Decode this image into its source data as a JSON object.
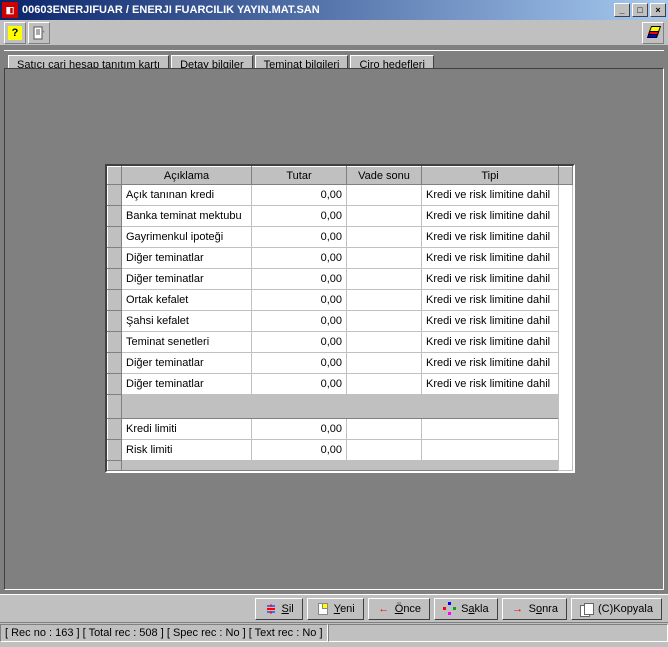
{
  "window": {
    "title": "00603ENERJIFUAR / ENERJI FUARCILIK YAYIN.MAT.SAN"
  },
  "tabs": [
    {
      "label": "Satıcı cari hesap tanıtım kartı",
      "active": false
    },
    {
      "label": "Detay bilgiler",
      "active": false
    },
    {
      "label": "Teminat bilgileri",
      "active": true
    },
    {
      "label": "Ciro hedefleri",
      "active": false
    }
  ],
  "table": {
    "headers": {
      "desc": "Açıklama",
      "amount": "Tutar",
      "due": "Vade sonu",
      "type": "Tipi"
    },
    "rows": [
      {
        "desc": "Açık tanınan kredi",
        "amount": "0,00",
        "due": "",
        "type": "Kredi ve risk limitine dahil"
      },
      {
        "desc": "Banka teminat mektubu",
        "amount": "0,00",
        "due": "",
        "type": "Kredi ve risk limitine dahil"
      },
      {
        "desc": "Gayrimenkul ipoteği",
        "amount": "0,00",
        "due": "",
        "type": "Kredi ve risk limitine dahil"
      },
      {
        "desc": "Diğer teminatlar",
        "amount": "0,00",
        "due": "",
        "type": "Kredi ve risk limitine dahil"
      },
      {
        "desc": "Diğer teminatlar",
        "amount": "0,00",
        "due": "",
        "type": "Kredi ve risk limitine dahil"
      },
      {
        "desc": "Ortak kefalet",
        "amount": "0,00",
        "due": "",
        "type": "Kredi ve risk limitine dahil"
      },
      {
        "desc": "Şahsi kefalet",
        "amount": "0,00",
        "due": "",
        "type": "Kredi ve risk limitine dahil"
      },
      {
        "desc": "Teminat senetleri",
        "amount": "0,00",
        "due": "",
        "type": "Kredi ve risk limitine dahil"
      },
      {
        "desc": "Diğer teminatlar",
        "amount": "0,00",
        "due": "",
        "type": "Kredi ve risk limitine dahil"
      },
      {
        "desc": "Diğer teminatlar",
        "amount": "0,00",
        "due": "",
        "type": "Kredi ve risk limitine dahil"
      }
    ],
    "summary": [
      {
        "desc": "Kredi limiti",
        "amount": "0,00"
      },
      {
        "desc": "Risk limiti",
        "amount": "0,00"
      }
    ]
  },
  "buttons": {
    "sil": "Sil",
    "yeni": "Yeni",
    "once": "Önce",
    "sakla": "Sakla",
    "sonra": "Sonra",
    "kopyala": "(C)Kopyala"
  },
  "status": {
    "text": "[ Rec no :   163 ] [ Total rec :   508 ] [ Spec rec : No ] [ Text rec : No ]"
  }
}
